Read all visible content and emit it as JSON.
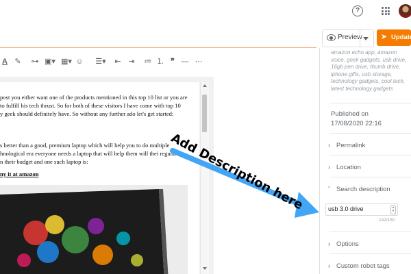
{
  "topbar": {
    "help_icon": "help-circle-icon",
    "apps_icon": "apps-grid-icon"
  },
  "header": {
    "preview_label": "Preview",
    "update_label": "Update",
    "accent_color": "#f57c00"
  },
  "toolbar": {
    "items": [
      "text-color-icon",
      "highlighter-icon",
      "link-icon",
      "image-icon",
      "video-icon",
      "emoji-icon",
      "align-icon",
      "indent-decrease-icon",
      "indent-increase-icon",
      "bulleted-list-icon",
      "numbered-list-icon",
      "quote-icon",
      "divider-icon",
      "more-icon"
    ]
  },
  "editor": {
    "paragraph1": [
      "post you either want one of the products mentioned in this top 10 list or you are",
      "to fulfill his tech thrust. So for both of these visitors I have come with top 10",
      "y geek should definitely have. So without any further ado let's get started:"
    ],
    "paragraph2": [
      "s better than a good, premium laptop which will help you to do multiple",
      "hnological era everyone needs a laptop that will help them will thei regular",
      "n their budget and one such laptop is:"
    ],
    "buy_link": "ny it at amazon"
  },
  "sidebar": {
    "labels_text": "amazon echo app, amazon voice, geek gadgets, usb drive, 16gb pen drive, thumb drive, iphone gifts, usb storage, technology gadgets, cool tech, latest technology gadgets",
    "published_label": "Published on",
    "published_date": "17/08/2020 22:16",
    "permalink": "Permalink",
    "location": "Location",
    "search_description": "Search description",
    "search_description_value": "usb 3.0 drive",
    "search_description_count": "142/150",
    "options": "Options",
    "custom_robot_tags": "Custom robot tags"
  },
  "annotation": {
    "text": "Add Description here",
    "arrow_color": "#42a5f5"
  }
}
